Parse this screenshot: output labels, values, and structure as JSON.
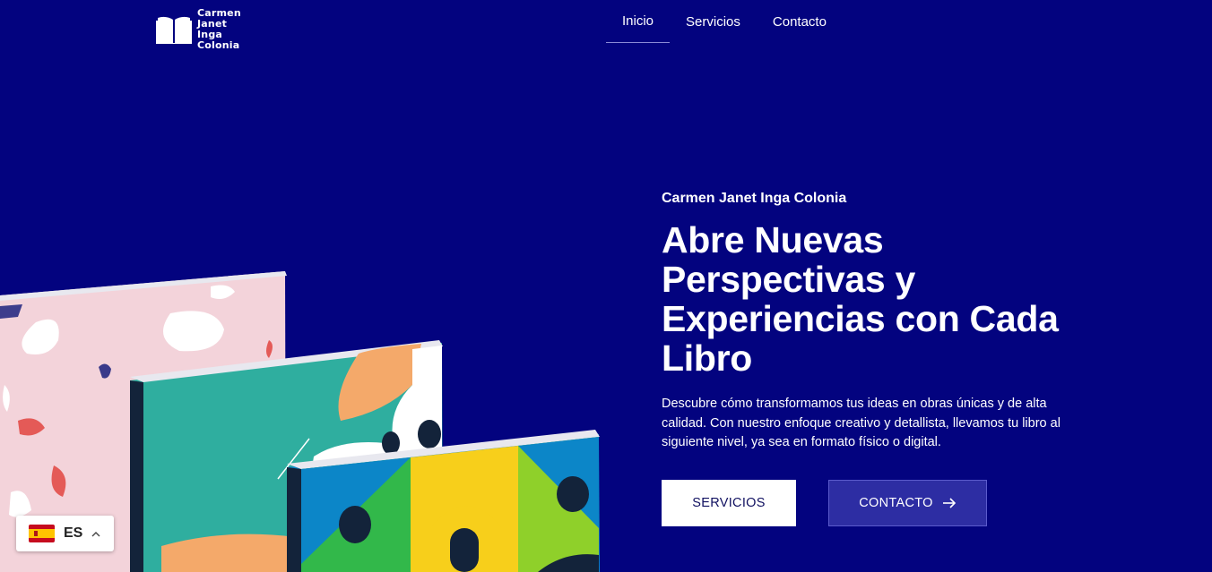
{
  "header": {
    "logo_lines": [
      "Carmen",
      "Janet",
      "Inga",
      "Colonia"
    ],
    "logo_icon": "open-book-icon",
    "nav": [
      {
        "label": "Inicio",
        "active": true
      },
      {
        "label": "Servicios",
        "active": false
      },
      {
        "label": "Contacto",
        "active": false
      }
    ]
  },
  "hero": {
    "eyebrow": "Carmen Janet Inga Colonia",
    "headline": "Abre Nuevas Perspectivas y Experiencias con Cada Libro",
    "description": "Descubre cómo transformamos tus ideas en obras únicas y de alta calidad. Con nuestro enfoque creativo y detallista, llevamos tu libro al siguiente nivel, ya sea en formato físico o digital.",
    "primary_button": "SERVICIOS",
    "secondary_button": "CONTACTO",
    "secondary_icon": "arrow-right-icon"
  },
  "language": {
    "code": "ES",
    "flag_icon": "spain-flag-icon",
    "chevron_icon": "chevron-up-icon"
  },
  "colors": {
    "background": "#03037f",
    "secondary_button": "#2d2da3",
    "primary_button": "#ffffff"
  }
}
